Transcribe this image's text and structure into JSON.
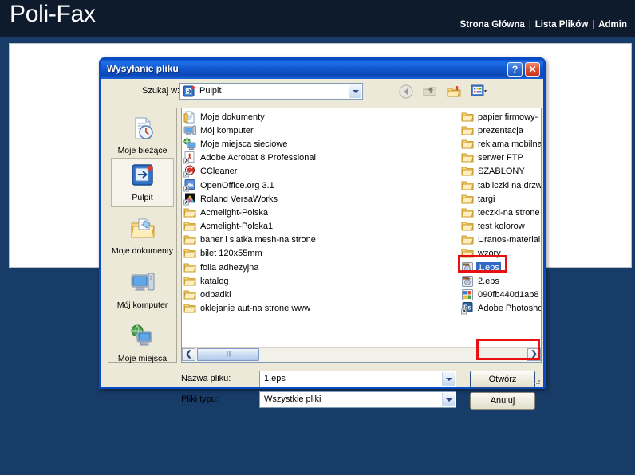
{
  "site": {
    "title": "Poli-Fax",
    "nav": [
      {
        "label": "Strona Główna"
      },
      {
        "label": "Lista Plików"
      },
      {
        "label": "Admin"
      }
    ],
    "nav_separator": "|"
  },
  "dialog": {
    "title": "Wysyłanie pliku",
    "help_button": "?",
    "close_button": "✕",
    "lookin": {
      "label": "Szukaj w:",
      "value": "Pulpit",
      "icon": "desktop-shortcut-icon"
    },
    "toolbar": [
      {
        "name": "back-icon"
      },
      {
        "name": "up-one-level-icon"
      },
      {
        "name": "new-folder-icon"
      },
      {
        "name": "views-icon"
      }
    ],
    "places": [
      {
        "label": "Moje bieżące dokumenty",
        "icon": "recent-documents-icon",
        "selected": false
      },
      {
        "label": "Pulpit",
        "icon": "desktop-icon",
        "selected": true
      },
      {
        "label": "Moje dokumenty",
        "icon": "my-documents-icon",
        "selected": false
      },
      {
        "label": "Mój komputer",
        "icon": "my-computer-icon",
        "selected": false
      },
      {
        "label": "Moje miejsca",
        "icon": "network-places-icon",
        "selected": false
      }
    ],
    "files_column_1": [
      {
        "name": "Moje dokumenty",
        "icon": "my-documents-icon",
        "selected": false
      },
      {
        "name": "Mój komputer",
        "icon": "my-computer-icon",
        "selected": false
      },
      {
        "name": "Moje miejsca sieciowe",
        "icon": "network-places-icon",
        "selected": false
      },
      {
        "name": "Adobe Acrobat 8 Professional",
        "icon": "acrobat-shortcut-icon",
        "selected": false
      },
      {
        "name": "CCleaner",
        "icon": "ccleaner-shortcut-icon",
        "selected": false
      },
      {
        "name": "OpenOffice.org 3.1",
        "icon": "openoffice-shortcut-icon",
        "selected": false
      },
      {
        "name": "Roland VersaWorks",
        "icon": "versaworks-shortcut-icon",
        "selected": false
      },
      {
        "name": "Acmelight-Polska",
        "icon": "folder-icon",
        "selected": false
      },
      {
        "name": "Acmelight-Polska1",
        "icon": "folder-icon",
        "selected": false
      },
      {
        "name": "baner i siatka mesh-na strone",
        "icon": "folder-icon",
        "selected": false
      },
      {
        "name": "bilet 120x55mm",
        "icon": "folder-icon",
        "selected": false
      },
      {
        "name": "folia adhezyjna",
        "icon": "folder-icon",
        "selected": false
      },
      {
        "name": "katalog",
        "icon": "folder-icon",
        "selected": false
      },
      {
        "name": "odpadki",
        "icon": "folder-icon",
        "selected": false
      },
      {
        "name": "oklejanie aut-na strone www",
        "icon": "folder-icon",
        "selected": false
      }
    ],
    "files_column_2": [
      {
        "name": "papier firmowy-",
        "icon": "folder-icon",
        "selected": false
      },
      {
        "name": "prezentacja",
        "icon": "folder-icon",
        "selected": false
      },
      {
        "name": "reklama mobilna",
        "icon": "folder-icon",
        "selected": false
      },
      {
        "name": "serwer FTP",
        "icon": "folder-icon",
        "selected": false
      },
      {
        "name": "SZABLONY",
        "icon": "folder-icon",
        "selected": false
      },
      {
        "name": "tabliczki na drzw",
        "icon": "folder-icon",
        "selected": false
      },
      {
        "name": "targi",
        "icon": "folder-icon",
        "selected": false
      },
      {
        "name": "teczki-na strone",
        "icon": "folder-icon",
        "selected": false
      },
      {
        "name": "test kolorow",
        "icon": "folder-icon",
        "selected": false
      },
      {
        "name": "Uranos-material",
        "icon": "folder-icon",
        "selected": false
      },
      {
        "name": "wzory",
        "icon": "folder-icon",
        "selected": false
      },
      {
        "name": "1.eps",
        "icon": "eps-file-icon",
        "selected": true
      },
      {
        "name": "2.eps",
        "icon": "eps-file-icon",
        "selected": false
      },
      {
        "name": "090fb440d1ab8",
        "icon": "image-file-icon",
        "selected": false
      },
      {
        "name": "Adobe Photosho",
        "icon": "photoshop-shortcut-icon",
        "selected": false
      }
    ],
    "filename": {
      "label": "Nazwa pliku:",
      "value": "1.eps"
    },
    "filetype": {
      "label": "Pliki typu:",
      "value": "Wszystkie pliki"
    },
    "buttons": {
      "open": "Otwórz",
      "cancel": "Anuluj"
    },
    "scrollbar": {
      "left_arrow": "❮",
      "right_arrow": "❯"
    }
  },
  "colors": {
    "header_bg": "#0d1b2c",
    "page_bg": "#173c68",
    "title_bar": "#0d57d4",
    "dialog_face": "#ece9d8",
    "selection": "#316ac5",
    "annotation": "#e81010"
  }
}
